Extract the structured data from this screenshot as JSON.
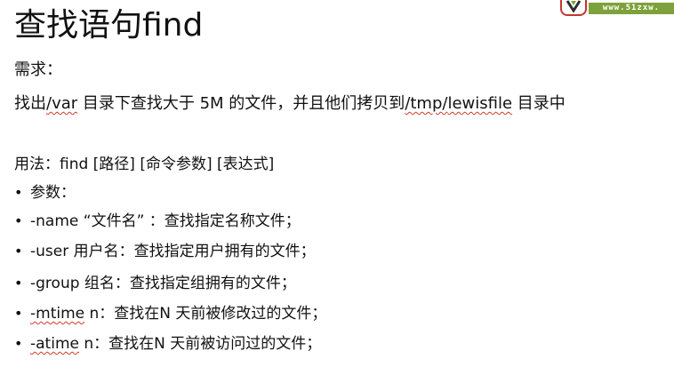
{
  "slide": {
    "title": "查找语句find",
    "logo": {
      "text": "www.51zxw.",
      "icon": "logo-badge-icon",
      "colors": {
        "strip": "#7ea23b",
        "badge_border": "#c2362c"
      }
    },
    "requirement": {
      "heading": "需求：",
      "text_prefix": "找出",
      "path_var": "/var",
      "text_middle": " 目录下查找大于 5M 的文件，并且他们拷贝到",
      "path_tmp": "/tmp/",
      "path_lewisfile": "lewisfile",
      "text_suffix": " 目录中"
    },
    "usage": "用法：find [路径] [命令参数] [表达式]",
    "bullets": [
      {
        "keyword": "参数：",
        "text": ""
      },
      {
        "keyword": "-name",
        "text": " “文件名” ：查找指定名称文件；"
      },
      {
        "keyword": "-user",
        "text": " 用户名：查找指定用户拥有的文件；"
      },
      {
        "keyword": "-group",
        "text": " 组名：查找指定组拥有的文件；"
      },
      {
        "keyword": "-mtime",
        "text": " n：查找在N 天前被修改过的文件；"
      },
      {
        "keyword": "-atime",
        "text": " n：查找在N 天前被访问过的文件；"
      }
    ],
    "bullet_symbol": "•"
  }
}
